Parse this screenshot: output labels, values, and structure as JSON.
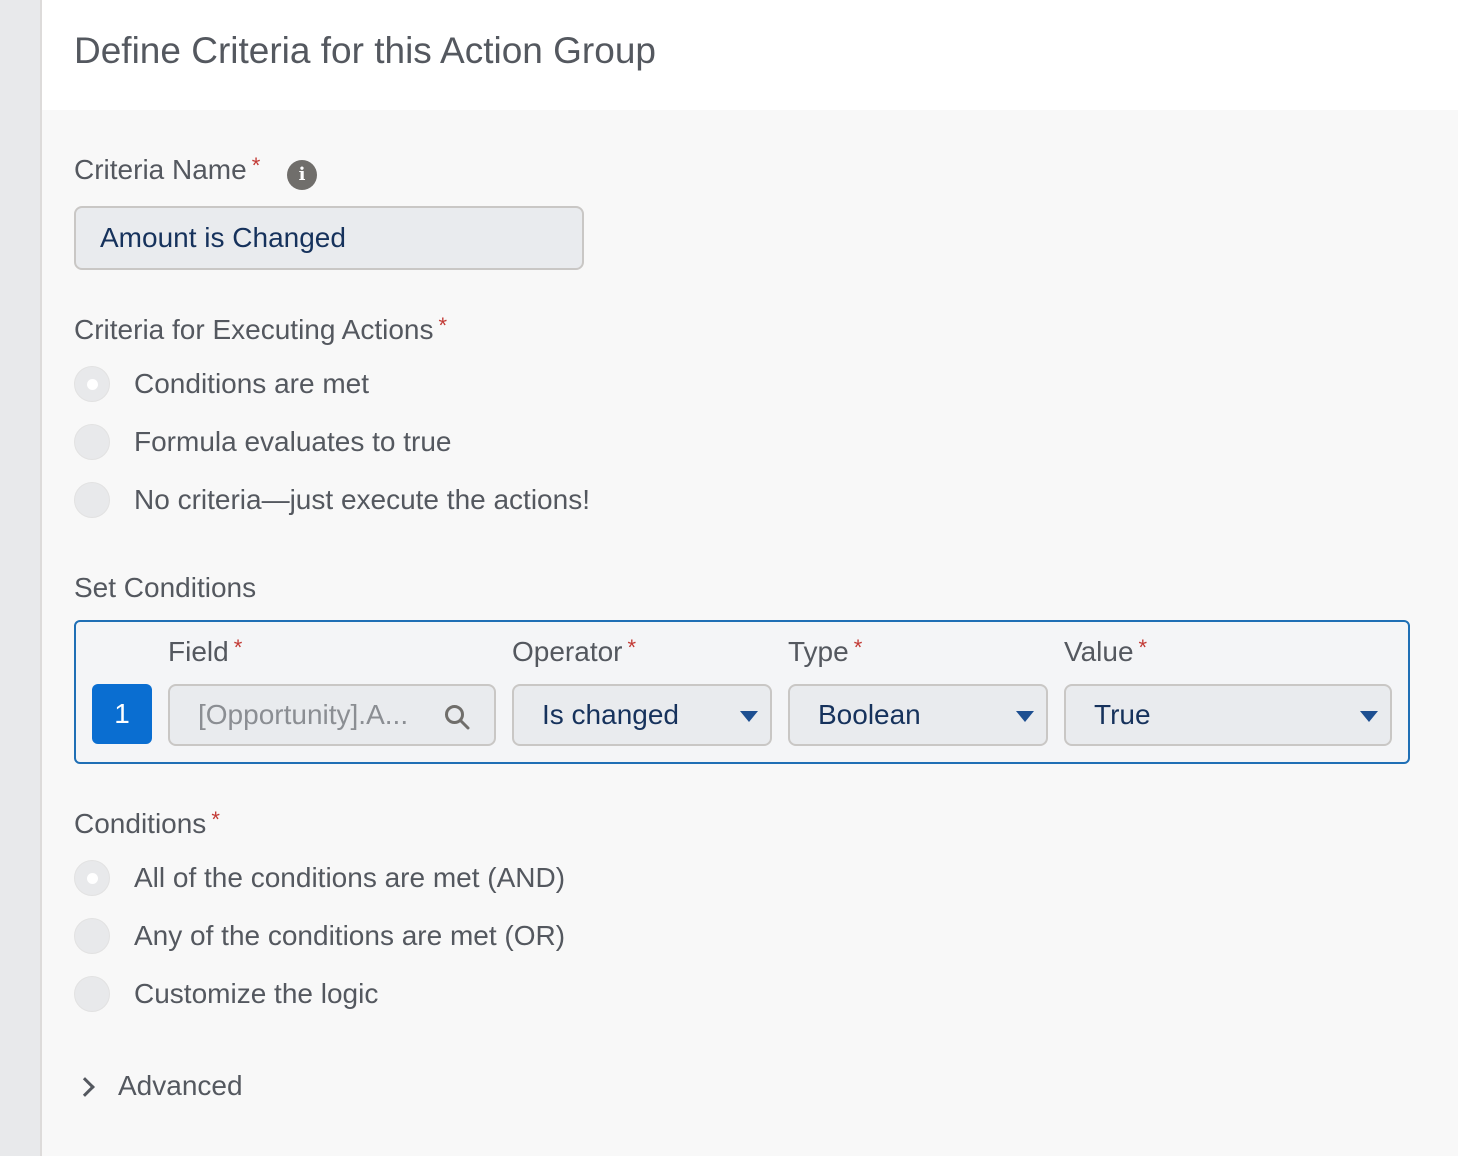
{
  "header": {
    "title": "Define Criteria for this Action Group"
  },
  "criteria_name": {
    "label": "Criteria Name",
    "required": "*",
    "value": "Amount is Changed",
    "icon": "info-icon"
  },
  "executing_criteria": {
    "label": "Criteria for Executing Actions",
    "required": "*",
    "options": [
      {
        "label": "Conditions are met",
        "selected": true
      },
      {
        "label": "Formula evaluates to true",
        "selected": false
      },
      {
        "label": "No criteria—just execute the actions!",
        "selected": false
      }
    ]
  },
  "set_conditions": {
    "label": "Set Conditions",
    "columns": {
      "field": "Field",
      "operator": "Operator",
      "type": "Type",
      "value": "Value",
      "required": "*"
    },
    "rows": [
      {
        "number": "1",
        "field": "[Opportunity].A...",
        "operator": "Is changed",
        "type": "Boolean",
        "value": "True"
      }
    ]
  },
  "conditions": {
    "label": "Conditions",
    "required": "*",
    "options": [
      {
        "label": "All of the conditions are met (AND)",
        "selected": true
      },
      {
        "label": "Any of the conditions are met (OR)",
        "selected": false
      },
      {
        "label": "Customize the logic",
        "selected": false
      }
    ]
  },
  "advanced": {
    "label": "Advanced",
    "icon": "chevron-right-icon"
  },
  "colors": {
    "accent": "#0a6ed1",
    "required": "#c23934",
    "selected_border": "#1f6fb5"
  }
}
